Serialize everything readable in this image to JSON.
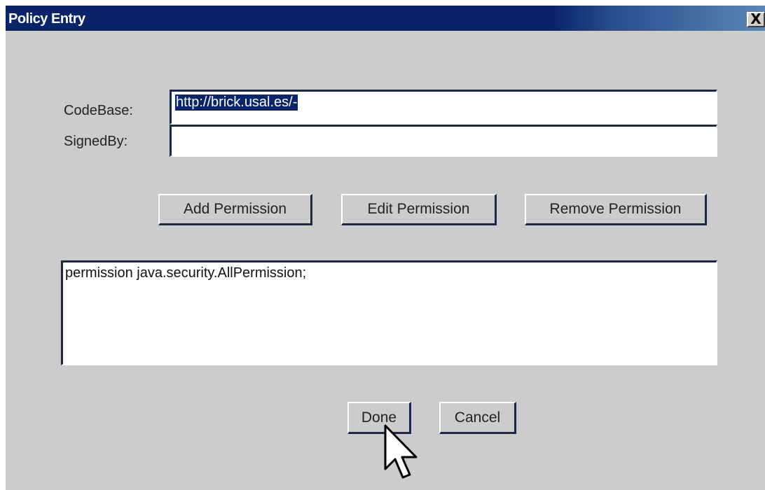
{
  "window": {
    "title": "Policy Entry",
    "close_label": "X"
  },
  "form": {
    "codebase_label": "CodeBase:",
    "codebase_value": "http://brick.usal.es/-",
    "signedby_label": "SignedBy:",
    "signedby_value": ""
  },
  "permission_buttons": {
    "add": "Add Permission",
    "edit": "Edit Permission",
    "remove": "Remove Permission"
  },
  "permissions_list": [
    "permission java.security.AllPermission;"
  ],
  "footer": {
    "done": "Done",
    "cancel": "Cancel"
  },
  "colors": {
    "titlebar": "#0a246a",
    "dialog_bg": "#cccccc",
    "selection": "#0a246a"
  }
}
